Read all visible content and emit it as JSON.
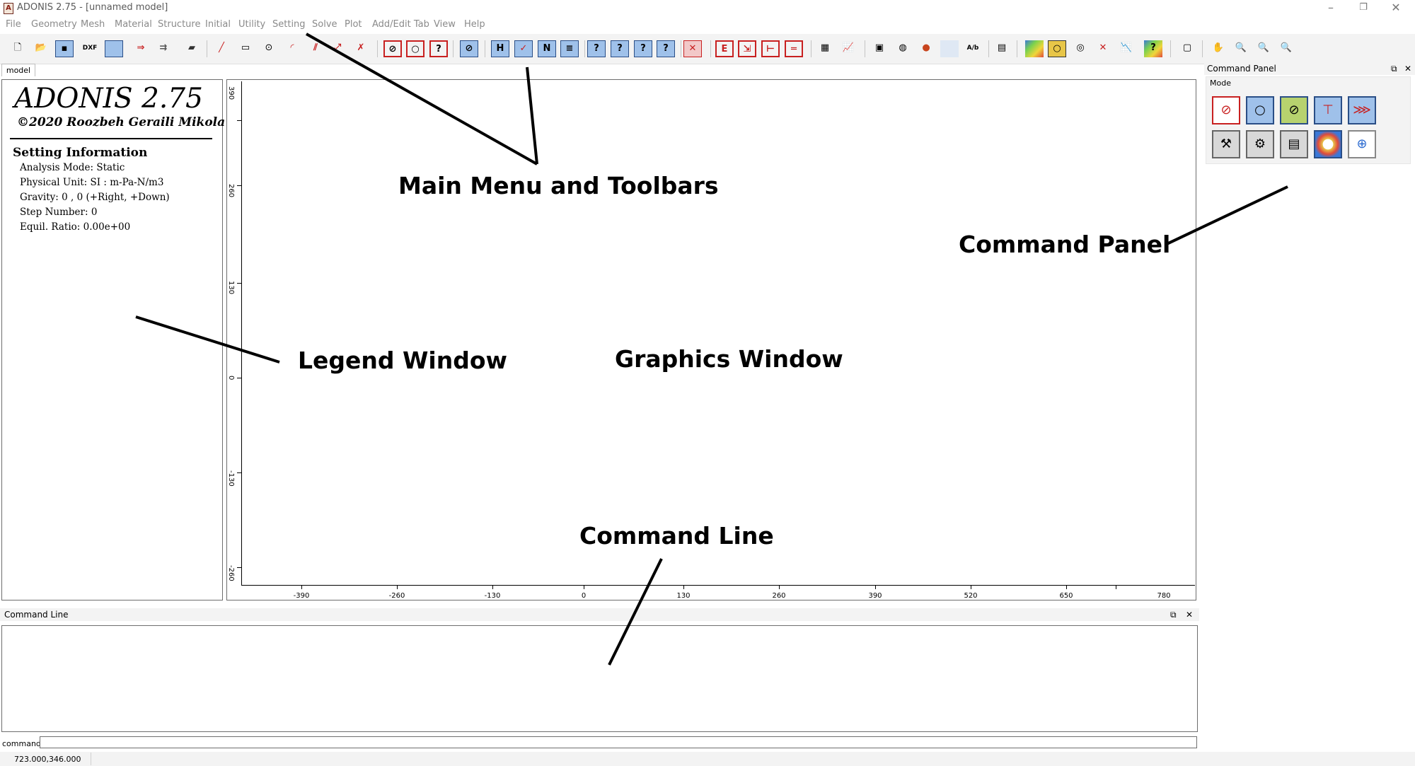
{
  "window": {
    "title": "ADONIS 2.75 - [unnamed model]",
    "minimize_glyph": "–",
    "restore_glyph": "❐",
    "close_glyph": "✕"
  },
  "menu": [
    "File",
    "Geometry",
    "Mesh",
    "Material",
    "Structure",
    "Initial",
    "Utility",
    "Setting",
    "Solve",
    "Plot",
    "Add/Edit Tab",
    "View",
    "Help"
  ],
  "toolbar": {
    "groups": [
      [
        "new-file-icon",
        "open-file-icon",
        "save-icon",
        "dxf-export-icon",
        "image-export-icon",
        "run-icon",
        "batch-run-icon",
        "print-icon"
      ],
      [
        "line-icon",
        "rectangle-icon",
        "circle-icon",
        "arc-icon",
        "polyline-icon",
        "node-icon",
        "delete-geometry-icon"
      ],
      [
        "query-icon",
        "boundary-icon",
        "help-icon"
      ],
      [
        "material-icon"
      ],
      [
        "mesh-h-icon",
        "mesh-v-icon",
        "mesh-diag-icon",
        "mesh-layer-icon"
      ],
      [
        "query-a-icon",
        "query-b-icon",
        "query-c-icon",
        "query-d-icon"
      ],
      [
        "remove-icon"
      ],
      [
        "support-icon",
        "load-icon",
        "displacement-icon",
        "interface-icon"
      ],
      [
        "table-icon",
        "plot-icon"
      ],
      [
        "history-icon",
        "record-icon",
        "color-icon",
        "label-icon",
        "text-icon"
      ],
      [
        "calculator-icon"
      ],
      [
        "contour-icon",
        "gold-icon",
        "ring-icon",
        "vector-icon",
        "graph-icon",
        "legend-help-icon"
      ],
      [
        "new-window-icon"
      ],
      [
        "pan-hand-icon",
        "zoom-icon",
        "zoom-in-icon",
        "zoom-out-icon"
      ]
    ]
  },
  "tab": {
    "label": "model"
  },
  "legend": {
    "title": "ADONIS 2.75",
    "copyright": "©2020 Roozbeh Geraili Mikola",
    "heading": "Setting Information",
    "lines": [
      "Analysis Mode: Static",
      "Physical Unit: SI : m-Pa-N/m3",
      "Gravity: 0 , 0 (+Right, +Down)",
      "Step Number: 0",
      "Equil. Ratio: 0.00e+00"
    ]
  },
  "graphics": {
    "x_ticks": [
      "-390",
      "-260",
      "-130",
      "0",
      "130",
      "260",
      "390",
      "520",
      "650",
      "780"
    ],
    "y_ticks": [
      "390",
      "260",
      "130",
      "0",
      "-130",
      "-260"
    ]
  },
  "command_panel": {
    "title": "Command Panel",
    "mode_label": "Mode",
    "float_glyph": "⧉",
    "close_glyph": "✕",
    "buttons": [
      "geometry-mode-icon",
      "boundary-mode-icon",
      "material-mode-icon",
      "support-mode-icon",
      "load-mode-icon",
      "tools-mode-icon",
      "settings-mode-icon",
      "calculator-mode-icon",
      "contour-mode-icon",
      "new-window-mode-icon"
    ]
  },
  "command_line": {
    "title": "Command Line",
    "float_glyph": "⧉",
    "close_glyph": "✕",
    "prompt_label": "command",
    "input_value": ""
  },
  "status": {
    "coords": "723.000,346.000"
  },
  "annotations": {
    "main_menu": "Main Menu and Toolbars",
    "command_panel": "Command Panel",
    "legend_window": "Legend Window",
    "graphics_window": "Graphics Window",
    "command_line": "Command Line"
  }
}
